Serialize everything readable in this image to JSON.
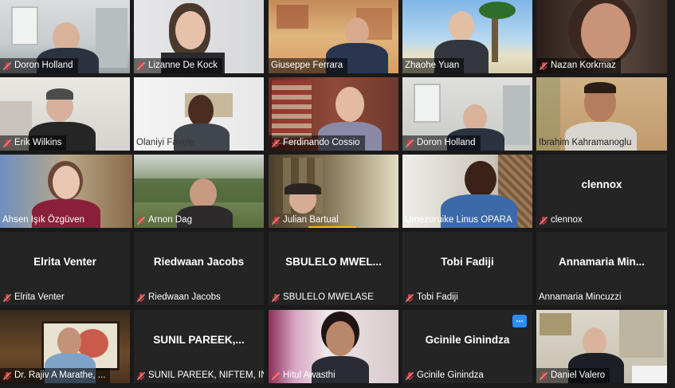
{
  "meeting": {
    "view": "gallery",
    "tiles": [
      {
        "name": "Doron Holland",
        "video": true,
        "muted": true
      },
      {
        "name": "Lizanne De Kock",
        "video": true,
        "muted": true
      },
      {
        "name": "Giuseppe Ferrara",
        "video": true,
        "muted": false
      },
      {
        "name": "Zhaohe Yuan",
        "video": true,
        "muted": false
      },
      {
        "name": "Nazan Korkmaz",
        "video": true,
        "muted": true
      },
      {
        "name": "Erik Wilkins",
        "video": true,
        "muted": true
      },
      {
        "name": "Olaniyi Favole",
        "video": true,
        "muted": false
      },
      {
        "name": "Ferdinando Cossio",
        "video": true,
        "muted": true
      },
      {
        "name": "Doron Holland",
        "video": true,
        "muted": true
      },
      {
        "name": "Ibrahim Kahramanoglu",
        "video": true,
        "muted": false
      },
      {
        "name": "Ahsen Işık Özgüven",
        "video": true,
        "muted": false,
        "active_speaker": true
      },
      {
        "name": "Arnon Dag",
        "video": true,
        "muted": true
      },
      {
        "name": "Julian Bartual",
        "video": true,
        "muted": true
      },
      {
        "name": "Umezuruike Linus OPARA",
        "video": true,
        "muted": false
      },
      {
        "name": "clennox",
        "video": false,
        "muted": true,
        "display_name": "clennox"
      },
      {
        "name": "Elrita Venter",
        "video": false,
        "muted": true,
        "display_name": "Elrita Venter"
      },
      {
        "name": "Riedwaan Jacobs",
        "video": false,
        "muted": true,
        "display_name": "Riedwaan Jacobs"
      },
      {
        "name": "SBULELO MWELASE",
        "video": false,
        "muted": true,
        "display_name": "SBULELO  MWEL..."
      },
      {
        "name": "Tobi Fadiji",
        "video": false,
        "muted": true,
        "display_name": "Tobi Fadiji"
      },
      {
        "name": "Annamaria Mincuzzi",
        "video": false,
        "muted": false,
        "display_name": "Annamaria  Min..."
      },
      {
        "name": "Dr. Rajiv A Marathe, ...",
        "video": true,
        "muted": true
      },
      {
        "name": "SUNIL PAREEK, NIFTEM, IN...",
        "video": false,
        "muted": true,
        "display_name": "SUNIL  PAREEK,..."
      },
      {
        "name": "Hitul Awasthi",
        "video": true,
        "muted": true
      },
      {
        "name": "Gcinile Ginindza",
        "video": false,
        "muted": true,
        "display_name": "Gcinile Ginindza",
        "more_button": "..."
      },
      {
        "name": "Daniel Valero",
        "video": true,
        "muted": true
      }
    ]
  },
  "colors": {
    "tile_bg": "#242424",
    "active_speaker_border": "#e6e36a",
    "muted_icon": "#e0383e",
    "accent": "#2d8cff"
  }
}
